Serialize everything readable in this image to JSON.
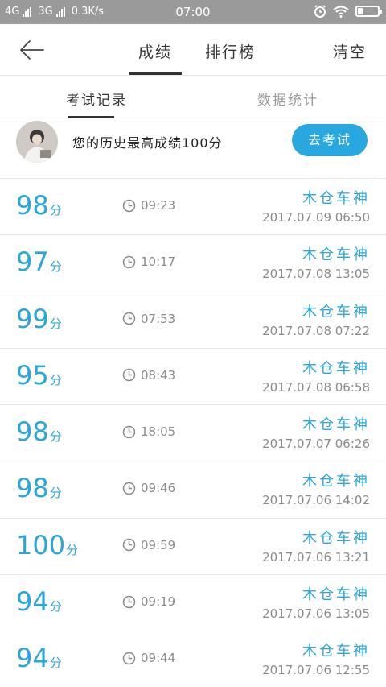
{
  "status": {
    "network_left": "4G",
    "network_right": "3G",
    "speed": "0.3K/s",
    "time": "07:00"
  },
  "nav": {
    "tab_score": "成绩",
    "tab_rank": "排行榜",
    "clear": "清空"
  },
  "subtabs": {
    "records": "考试记录",
    "stats": "数据统计"
  },
  "summary": {
    "best_text": "您的历史最高成绩100分",
    "go_button": "去考试"
  },
  "unit": "分",
  "records": [
    {
      "score": "98",
      "duration": "09:23",
      "name": "木仓车神",
      "date": "2017.07.09  06:50"
    },
    {
      "score": "97",
      "duration": "10:17",
      "name": "木仓车神",
      "date": "2017.07.08  13:05"
    },
    {
      "score": "99",
      "duration": "07:53",
      "name": "木仓车神",
      "date": "2017.07.08  07:22"
    },
    {
      "score": "95",
      "duration": "08:43",
      "name": "木仓车神",
      "date": "2017.07.08  06:58"
    },
    {
      "score": "98",
      "duration": "18:05",
      "name": "木仓车神",
      "date": "2017.07.07  06:26"
    },
    {
      "score": "98",
      "duration": "09:46",
      "name": "木仓车神",
      "date": "2017.07.06  14:02"
    },
    {
      "score": "100",
      "duration": "09:59",
      "name": "木仓车神",
      "date": "2017.07.06  13:21"
    },
    {
      "score": "94",
      "duration": "09:19",
      "name": "木仓车神",
      "date": "2017.07.06  13:05"
    },
    {
      "score": "94",
      "duration": "09:44",
      "name": "木仓车神",
      "date": "2017.07.06  12:55"
    }
  ],
  "colors": {
    "accent": "#2aa6db",
    "button": "#29a8e0",
    "statusbar": "#9a9a9a"
  }
}
